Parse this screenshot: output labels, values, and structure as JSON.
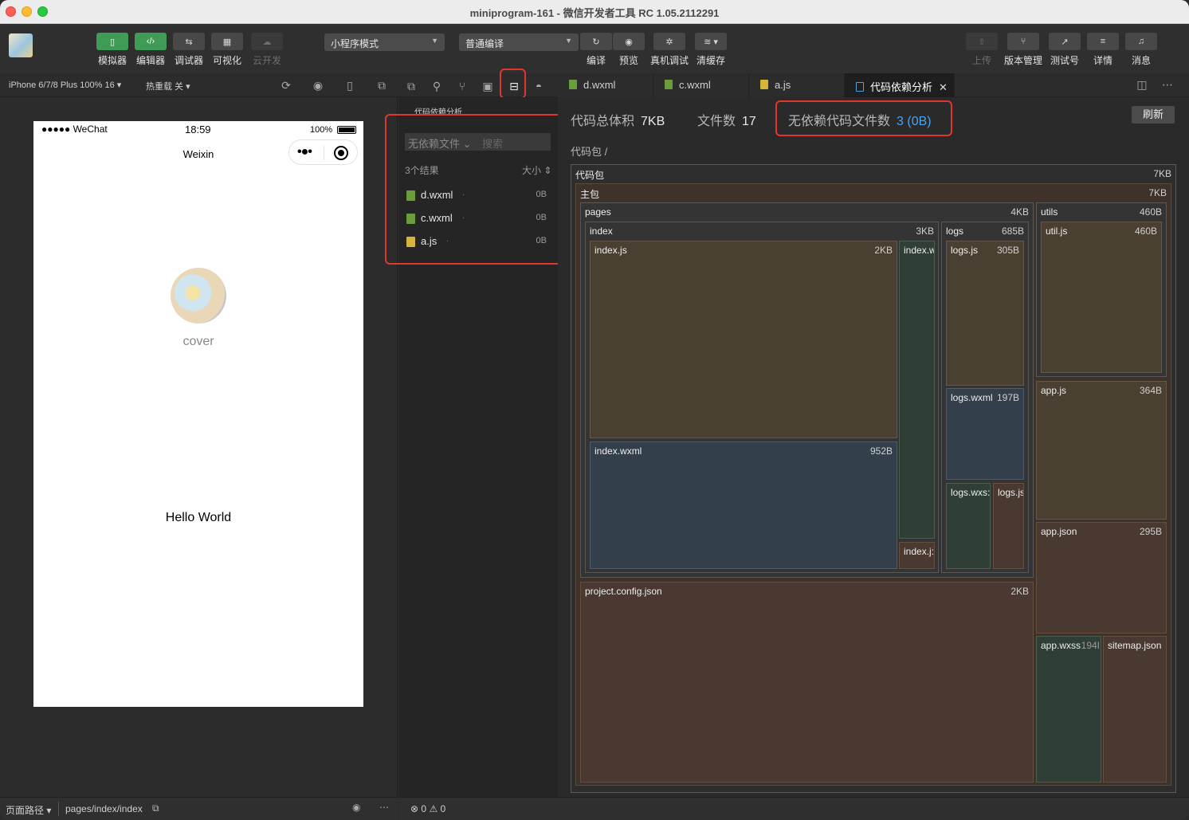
{
  "window": {
    "title": "miniprogram-161 - 微信开发者工具 RC 1.05.2112291"
  },
  "toolbar": {
    "buttons": [
      {
        "label": "模拟器",
        "icon": "phone-icon"
      },
      {
        "label": "编辑器",
        "icon": "code-icon"
      },
      {
        "label": "调试器",
        "icon": "debug-icon"
      },
      {
        "label": "可视化",
        "icon": "layout-icon"
      },
      {
        "label": "云开发",
        "icon": "cloud-icon"
      }
    ],
    "mode_select": "小程序模式",
    "compile_select": "普通编译",
    "actions": [
      {
        "label": "编译",
        "icon": "refresh-icon"
      },
      {
        "label": "预览",
        "icon": "eye-icon"
      },
      {
        "label": "真机调试",
        "icon": "bug-icon"
      },
      {
        "label": "清缓存",
        "icon": "layers-icon"
      }
    ],
    "right_actions": [
      {
        "label": "上传",
        "icon": "upload-icon"
      },
      {
        "label": "版本管理",
        "icon": "branch-icon"
      },
      {
        "label": "测试号",
        "icon": "external-icon"
      },
      {
        "label": "详情",
        "icon": "menu-icon"
      },
      {
        "label": "消息",
        "icon": "bell-icon"
      }
    ]
  },
  "simulator": {
    "device": "iPhone 6/7/8 Plus 100% 16 ▾",
    "hot_reload": "热重载 关 ▾",
    "status_left": "●●●●● WeChat",
    "status_time": "18:59",
    "status_battery": "100%",
    "nav_title": "Weixin",
    "cover_label": "cover",
    "hello_text": "Hello World",
    "footer_path_label": "页面路径 ▾",
    "footer_path": "pages/index/index"
  },
  "tabs": [
    {
      "label": "d.wxml",
      "type": "wxml"
    },
    {
      "label": "c.wxml",
      "type": "wxml"
    },
    {
      "label": "a.js",
      "type": "js"
    },
    {
      "label": "代码依赖分析",
      "type": "doc",
      "active": true
    }
  ],
  "analysis": {
    "panel_title": "代码依赖分析",
    "filter_dropdown": "无依赖文件 ⌄",
    "search_placeholder": "搜索",
    "results_count": "3个结果",
    "sort_label": "大小 ⇕",
    "files": [
      {
        "name": "d.wxml",
        "dot": ".",
        "size": "0B",
        "type": "wxml"
      },
      {
        "name": "c.wxml",
        "dot": ".",
        "size": "0B",
        "type": "wxml"
      },
      {
        "name": "a.js",
        "dot": ".",
        "size": "0B",
        "type": "js"
      }
    ],
    "total_size_label": "代码总体积",
    "total_size": "7KB",
    "file_count_label": "文件数",
    "file_count": "17",
    "unused_label": "无依赖代码文件数",
    "unused_value": "3 (0B)",
    "refresh_label": "刷新",
    "breadcrumb": "代码包 /"
  },
  "treemap": [
    {
      "key": "root",
      "name": "代码包",
      "size": "7KB"
    },
    {
      "key": "main",
      "name": "主包",
      "size": "7KB"
    },
    {
      "key": "pages",
      "name": "pages",
      "size": "4KB"
    },
    {
      "key": "index",
      "name": "index",
      "size": "3KB"
    },
    {
      "key": "indexjs",
      "name": "index.js",
      "size": "2KB"
    },
    {
      "key": "indexwxml",
      "name": "index.wxml",
      "size": "952B"
    },
    {
      "key": "indexw2",
      "name": "index.w",
      "size": ""
    },
    {
      "key": "indexj2",
      "name": "index.j:",
      "size": ""
    },
    {
      "key": "logs",
      "name": "logs",
      "size": "685B"
    },
    {
      "key": "logsjs",
      "name": "logs.js",
      "size": "305B"
    },
    {
      "key": "logswxml",
      "name": "logs.wxml",
      "size": "197B"
    },
    {
      "key": "logswxss",
      "name": "logs.wxs:",
      "size": ""
    },
    {
      "key": "logsjs2",
      "name": "logs.js",
      "size": ""
    },
    {
      "key": "utils",
      "name": "utils",
      "size": "460B"
    },
    {
      "key": "utiljs",
      "name": "util.js",
      "size": "460B"
    },
    {
      "key": "appjs",
      "name": "app.js",
      "size": "364B"
    },
    {
      "key": "appjson",
      "name": "app.json",
      "size": "295B"
    },
    {
      "key": "appwxss",
      "name": "app.wxss",
      "size": "194I"
    },
    {
      "key": "sitemap",
      "name": "sitemap.json",
      "size": ""
    },
    {
      "key": "projcfg",
      "name": "project.config.json",
      "size": "2KB"
    }
  ],
  "debug_footer": {
    "errors": "0",
    "warnings": "0"
  },
  "colors": {
    "accent_green": "#3f9b55",
    "highlight_red": "#e0362c",
    "link_blue": "#4aa3ec"
  }
}
